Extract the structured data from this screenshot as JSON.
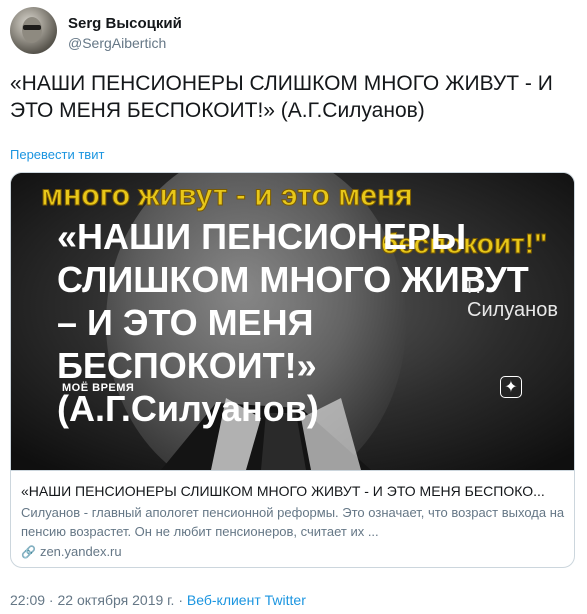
{
  "user": {
    "name": "Serg Высоцкий",
    "handle": "@SergAibertich"
  },
  "tweet": {
    "text": "«НАШИ ПЕНСИОНЕРЫ СЛИШКОМ МНОГО ЖИВУТ - И ЭТО МЕНЯ БЕСПОКОИТ!» (А.Г.Силуанов)",
    "translate_label": "Перевести твит"
  },
  "card": {
    "image": {
      "banner_top": "много живут - и это меня",
      "banner_right": "беспокоит!\"",
      "title": "«НАШИ ПЕНСИОНЕРЫ СЛИШКОМ МНОГО ЖИВУТ – И ЭТО МЕНЯ БЕСПОКОИТ!» (А.Г.Силуанов)",
      "name_overlay": "Г. Силуанов",
      "caption": "МОЁ ВРЕМЯ",
      "logo_glyph": "✦"
    },
    "title": "«НАШИ ПЕНСИОНЕРЫ СЛИШКОМ МНОГО ЖИВУТ - И ЭТО МЕНЯ БЕСПОКО...",
    "description": "Силуанов - главный апологет пенсионной реформы. Это означает, что возраст выхода на пенсию возрастет. Он не любит пенсионеров, считает их ...",
    "domain": "zen.yandex.ru",
    "domain_icon": "link-icon"
  },
  "footer": {
    "timestamp": "22:09 · 22 октября 2019 г. ·",
    "client": "Веб-клиент Twitter"
  },
  "colors": {
    "link": "#1b95e0",
    "secondary": "#657786",
    "banner_yellow": "#e8c81a"
  }
}
